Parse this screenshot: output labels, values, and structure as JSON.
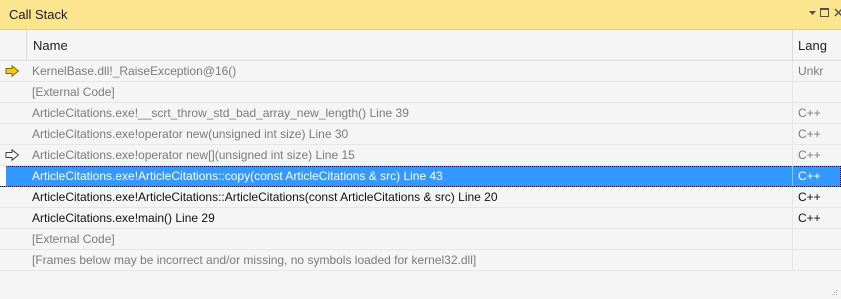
{
  "window": {
    "title": "Call Stack",
    "controls": {
      "dropdown_icon": "dropdown-arrow-icon",
      "maximize_icon": "maximize-icon",
      "close_icon": "close-icon"
    }
  },
  "columns": {
    "name": "Name",
    "language": "Lang"
  },
  "colors": {
    "title_bar": "#fbe68f",
    "selection": "#3399ff",
    "current_frame_arrow": "#f2c811",
    "caller_frame_arrow": "#ffffff"
  },
  "frames": [
    {
      "name": "KernelBase.dll!_RaiseException@16()",
      "language": "Unkr",
      "style": "gray",
      "marker": "current-frame-arrow-icon"
    },
    {
      "name": "[External Code]",
      "language": "",
      "style": "gray",
      "marker": ""
    },
    {
      "name": "ArticleCitations.exe!__scrt_throw_std_bad_array_new_length() Line 39",
      "language": "C++",
      "style": "gray",
      "marker": ""
    },
    {
      "name": "ArticleCitations.exe!operator new(unsigned int size) Line 30",
      "language": "C++",
      "style": "gray",
      "marker": ""
    },
    {
      "name": "ArticleCitations.exe!operator new[](unsigned int size) Line 15",
      "language": "C++",
      "style": "gray",
      "marker": "caller-frame-arrow-icon"
    },
    {
      "name": "ArticleCitations.exe!ArticleCitations::copy(const ArticleCitations & src) Line 43",
      "language": "C++",
      "style": "selected",
      "marker": ""
    },
    {
      "name": "ArticleCitations.exe!ArticleCitations::ArticleCitations(const ArticleCitations & src) Line 20",
      "language": "C++",
      "style": "normal",
      "marker": ""
    },
    {
      "name": "ArticleCitations.exe!main() Line 29",
      "language": "C++",
      "style": "normal",
      "marker": ""
    },
    {
      "name": "[External Code]",
      "language": "",
      "style": "gray",
      "marker": ""
    },
    {
      "name": "[Frames below may be incorrect and/or missing, no symbols loaded for kernel32.dll]",
      "language": "",
      "style": "gray",
      "marker": ""
    }
  ]
}
